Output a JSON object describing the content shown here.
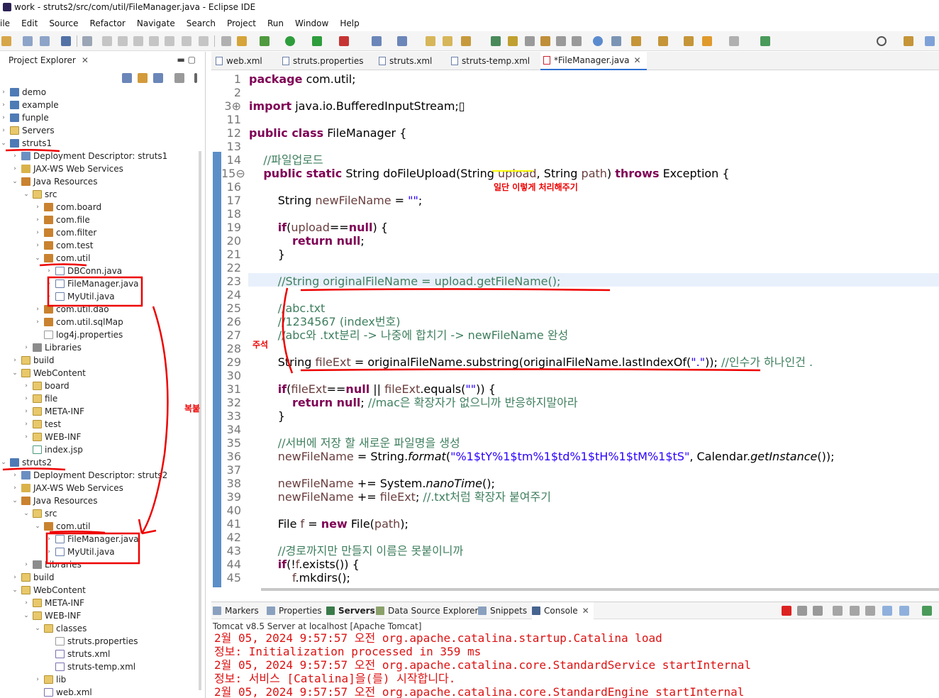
{
  "window": {
    "title": "work - struts2/src/com/util/FileManager.java - Eclipse IDE"
  },
  "menu": [
    "ile",
    "Edit",
    "Source",
    "Refactor",
    "Navigate",
    "Search",
    "Project",
    "Run",
    "Window",
    "Help"
  ],
  "explorer": {
    "title": "Project Explorer",
    "tree": [
      {
        "label": "demo",
        "icon": "project-icon",
        "indent": 0,
        "arrow": "›"
      },
      {
        "label": "example",
        "icon": "project-icon",
        "indent": 0,
        "arrow": "›"
      },
      {
        "label": "funple",
        "icon": "project-icon",
        "indent": 0,
        "arrow": "›"
      },
      {
        "label": "Servers",
        "icon": "folder-icon",
        "indent": 0,
        "arrow": "›"
      },
      {
        "label": "struts1",
        "icon": "project-icon",
        "indent": 0,
        "arrow": "⌄"
      },
      {
        "label": "Deployment Descriptor: struts1",
        "icon": "deployment-descriptor-icon",
        "indent": 1,
        "arrow": "›"
      },
      {
        "label": "JAX-WS Web Services",
        "icon": "web-services-icon",
        "indent": 1,
        "arrow": "›"
      },
      {
        "label": "Java Resources",
        "icon": "java-resources-icon",
        "indent": 1,
        "arrow": "⌄"
      },
      {
        "label": "src",
        "icon": "source-folder-icon",
        "indent": 2,
        "arrow": "⌄"
      },
      {
        "label": "com.board",
        "icon": "package-icon",
        "indent": 3,
        "arrow": "›"
      },
      {
        "label": "com.file",
        "icon": "package-icon",
        "indent": 3,
        "arrow": "›"
      },
      {
        "label": "com.filter",
        "icon": "package-icon",
        "indent": 3,
        "arrow": "›"
      },
      {
        "label": "com.test",
        "icon": "package-icon",
        "indent": 3,
        "arrow": "›"
      },
      {
        "label": "com.util",
        "icon": "package-icon",
        "indent": 3,
        "arrow": "⌄"
      },
      {
        "label": "DBConn.java",
        "icon": "java-file-icon",
        "indent": 4,
        "arrow": "›"
      },
      {
        "label": "FileManager.java",
        "icon": "java-file-icon",
        "indent": 4,
        "arrow": "›"
      },
      {
        "label": "MyUtil.java",
        "icon": "java-file-icon",
        "indent": 4,
        "arrow": "›"
      },
      {
        "label": "com.util.dao",
        "icon": "package-icon",
        "indent": 3,
        "arrow": "›"
      },
      {
        "label": "com.util.sqlMap",
        "icon": "package-icon",
        "indent": 3,
        "arrow": "›"
      },
      {
        "label": "log4j.properties",
        "icon": "properties-file-icon",
        "indent": 3,
        "arrow": ""
      },
      {
        "label": "Libraries",
        "icon": "libraries-icon",
        "indent": 2,
        "arrow": "›"
      },
      {
        "label": "build",
        "icon": "folder-icon",
        "indent": 1,
        "arrow": "›"
      },
      {
        "label": "WebContent",
        "icon": "folder-icon",
        "indent": 1,
        "arrow": "⌄"
      },
      {
        "label": "board",
        "icon": "folder-icon",
        "indent": 2,
        "arrow": "›"
      },
      {
        "label": "file",
        "icon": "folder-icon",
        "indent": 2,
        "arrow": "›"
      },
      {
        "label": "META-INF",
        "icon": "folder-icon",
        "indent": 2,
        "arrow": "›"
      },
      {
        "label": "test",
        "icon": "folder-icon",
        "indent": 2,
        "arrow": "›"
      },
      {
        "label": "WEB-INF",
        "icon": "folder-icon",
        "indent": 2,
        "arrow": "›"
      },
      {
        "label": "index.jsp",
        "icon": "jsp-file-icon",
        "indent": 2,
        "arrow": ""
      },
      {
        "label": "struts2",
        "icon": "project-icon",
        "indent": 0,
        "arrow": "⌄"
      },
      {
        "label": "Deployment Descriptor: struts2",
        "icon": "deployment-descriptor-icon",
        "indent": 1,
        "arrow": "›"
      },
      {
        "label": "JAX-WS Web Services",
        "icon": "web-services-icon",
        "indent": 1,
        "arrow": "›"
      },
      {
        "label": "Java Resources",
        "icon": "java-resources-icon",
        "indent": 1,
        "arrow": "⌄"
      },
      {
        "label": "src",
        "icon": "source-folder-icon",
        "indent": 2,
        "arrow": "⌄"
      },
      {
        "label": "com.util",
        "icon": "package-icon",
        "indent": 3,
        "arrow": "⌄"
      },
      {
        "label": "FileManager.java",
        "icon": "java-file-icon",
        "indent": 4,
        "arrow": "›"
      },
      {
        "label": "MyUtil.java",
        "icon": "java-file-icon",
        "indent": 4,
        "arrow": "›"
      },
      {
        "label": "Libraries",
        "icon": "libraries-icon",
        "indent": 2,
        "arrow": "›"
      },
      {
        "label": "build",
        "icon": "folder-icon",
        "indent": 1,
        "arrow": "›"
      },
      {
        "label": "WebContent",
        "icon": "folder-icon",
        "indent": 1,
        "arrow": "⌄"
      },
      {
        "label": "META-INF",
        "icon": "folder-icon",
        "indent": 2,
        "arrow": "›"
      },
      {
        "label": "WEB-INF",
        "icon": "folder-icon",
        "indent": 2,
        "arrow": "⌄"
      },
      {
        "label": "classes",
        "icon": "folder-icon",
        "indent": 3,
        "arrow": "⌄"
      },
      {
        "label": "struts.properties",
        "icon": "properties-file-icon",
        "indent": 4,
        "arrow": ""
      },
      {
        "label": "struts.xml",
        "icon": "xml-file-icon",
        "indent": 4,
        "arrow": ""
      },
      {
        "label": "struts-temp.xml",
        "icon": "xml-file-icon",
        "indent": 4,
        "arrow": ""
      },
      {
        "label": "lib",
        "icon": "folder-icon",
        "indent": 3,
        "arrow": "›"
      },
      {
        "label": "web.xml",
        "icon": "xml-file-icon",
        "indent": 3,
        "arrow": ""
      }
    ]
  },
  "editor": {
    "tabs": [
      {
        "label": "web.xml",
        "active": false
      },
      {
        "label": "struts.properties",
        "active": false
      },
      {
        "label": "struts.xml",
        "active": false
      },
      {
        "label": "struts-temp.xml",
        "active": false
      },
      {
        "label": "*FileManager.java",
        "active": true
      }
    ],
    "lines": [
      {
        "n": "1",
        "html": "<span class=\"kw\">package</span> com.util;"
      },
      {
        "n": "2",
        "html": ""
      },
      {
        "n": "3⊕",
        "html": "<span class=\"kw\">import</span> java.io.BufferedInputStream;▯"
      },
      {
        "n": "11",
        "html": ""
      },
      {
        "n": "12",
        "html": "<span class=\"kw\">public class</span> FileManager {"
      },
      {
        "n": "13",
        "html": ""
      },
      {
        "n": "14",
        "html": "    <span class=\"cm\">//파일업로드</span>"
      },
      {
        "n": "15⊖",
        "html": "    <span class=\"kw\">public static</span> String doFileUpload(String <span class=\"fld\">upload</span>, String <span class=\"fld\">path</span>) <span class=\"kw\">throws</span> Exception {"
      },
      {
        "n": "16",
        "html": ""
      },
      {
        "n": "17",
        "html": "        String <span class=\"fld\">newFileName</span> = <span class=\"str\">\"\"</span>;"
      },
      {
        "n": "18",
        "html": ""
      },
      {
        "n": "19",
        "html": "        <span class=\"kw\">if</span>(<span class=\"fld\">upload</span>==<span class=\"kw\">null</span>) {"
      },
      {
        "n": "20",
        "html": "            <span class=\"kw\">return null</span>;"
      },
      {
        "n": "21",
        "html": "        }"
      },
      {
        "n": "22",
        "html": ""
      },
      {
        "n": "23",
        "html": "        <span class=\"cm\">//String originalFileName = upload.getFileName();</span>"
      },
      {
        "n": "24",
        "html": ""
      },
      {
        "n": "25",
        "html": "        <span class=\"cm\">//abc.txt</span>"
      },
      {
        "n": "26",
        "html": "        <span class=\"cm\">//1234567 (index번호)</span>"
      },
      {
        "n": "27",
        "html": "        <span class=\"cm\">//abc와 .txt분리 -> 나중에 합치기 -> newFileName 완성</span>"
      },
      {
        "n": "28",
        "html": ""
      },
      {
        "n": "29",
        "html": "        String <span class=\"fld\">fileExt</span> = originalFileName.substring(originalFileName.lastIndexOf(<span class=\"str\">\".\"</span>)); <span class=\"cm\">//인수가 하나인건 .</span>"
      },
      {
        "n": "30",
        "html": ""
      },
      {
        "n": "31",
        "html": "        <span class=\"kw\">if</span>(<span class=\"fld\">fileExt</span>==<span class=\"kw\">null</span> || <span class=\"fld\">fileExt</span>.equals(<span class=\"str\">\"\"</span>)) {"
      },
      {
        "n": "32",
        "html": "            <span class=\"kw\">return null</span>; <span class=\"cm\">//mac은 확장자가 없으니까 반응하지말아라</span>"
      },
      {
        "n": "33",
        "html": "        }"
      },
      {
        "n": "34",
        "html": ""
      },
      {
        "n": "35",
        "html": "        <span class=\"cm\">//서버에 저장 할 새로운 파일명을 생성</span>"
      },
      {
        "n": "36",
        "html": "        <span class=\"fld\">newFileName</span> = String.<span class=\"it\">format</span>(<span class=\"str\">\"%1$tY%1$tm%1$td%1$tH%1$tM%1$tS\"</span>, Calendar.<span class=\"it\">getInstance</span>());"
      },
      {
        "n": "37",
        "html": ""
      },
      {
        "n": "38",
        "html": "        <span class=\"fld\">newFileName</span> += System.<span class=\"it\">nanoTime</span>();"
      },
      {
        "n": "39",
        "html": "        <span class=\"fld\">newFileName</span> += <span class=\"fld\">fileExt</span>; <span class=\"cm\">//.txt처럼 확장자 붙여주기</span>"
      },
      {
        "n": "40",
        "html": ""
      },
      {
        "n": "41",
        "html": "        File <span class=\"fld\">f</span> = <span class=\"kw\">new</span> File(<span class=\"fld\">path</span>);"
      },
      {
        "n": "42",
        "html": ""
      },
      {
        "n": "43",
        "html": "        <span class=\"cm\">//경로까지만 만들지 이름은 못붙이니까</span>"
      },
      {
        "n": "44",
        "html": "        <span class=\"kw\">if</span>(!<span class=\"fld\">f</span>.exists()) {"
      },
      {
        "n": "45",
        "html": "            <span class=\"fld\">f</span>.mkdirs();"
      }
    ]
  },
  "console": {
    "tabs": [
      "Markers",
      "Properties",
      "Servers",
      "Data Source Explorer",
      "Snippets",
      "Console"
    ],
    "header": "Tomcat v8.5 Server at localhost [Apache Tomcat]",
    "lines": [
      "2월 05, 2024 9:57:57 오전 org.apache.catalina.startup.Catalina load",
      "정보: Initialization processed in 359 ms",
      "2월 05, 2024 9:57:57 오전 org.apache.catalina.core.StandardService startInternal",
      "정보: 서비스 [Catalina]을(를) 시작합니다.",
      "2월 05, 2024 9:57:57 오전 org.apache.catalina.core.StandardEngine startInternal"
    ]
  },
  "annotations": {
    "note_1": "일단 이렇게 처리해주기",
    "note_2": "주석",
    "note_3": "복붙"
  }
}
